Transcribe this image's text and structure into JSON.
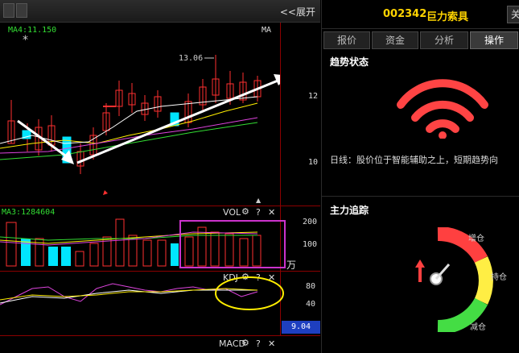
{
  "toolbar": {
    "expand_label": "<<展开"
  },
  "kline": {
    "ma_label": "MA4:11.150",
    "ma_right": "MA",
    "high_marker": "13.06",
    "y_ticks": [
      "12",
      "10"
    ],
    "star": "*"
  },
  "volume": {
    "ma_label": "MA3:1284604",
    "indicator": "VOL",
    "y_ticks": [
      "200",
      "100"
    ],
    "unit": "万"
  },
  "kdj": {
    "indicator": "KDJ",
    "y_ticks": [
      "80",
      "40"
    ],
    "value": "9.04"
  },
  "macd": {
    "indicator": "MACD"
  },
  "icons": {
    "gear": "⚙",
    "help": "?",
    "close": "✕"
  },
  "right": {
    "code": "002342",
    "name": "巨力索具",
    "corner_btn": "关",
    "tabs": [
      {
        "label": "报价"
      },
      {
        "label": "资金"
      },
      {
        "label": "分析"
      },
      {
        "label": "操作"
      }
    ],
    "active_tab": "操作",
    "trend_title": "趋势状态",
    "trend_text": "日线：股价位于智能辅助之上，短期趋势向",
    "tracking_title": "主力追踪",
    "gauge_labels": {
      "increase": "增仓",
      "hold": "持仓",
      "decrease": "减仓"
    }
  },
  "colors": {
    "up": "#ff3030",
    "down": "#00e5ff",
    "accent_box": "#cc33cc",
    "ellipse": "#ffee00",
    "title": "#ffd400"
  }
}
